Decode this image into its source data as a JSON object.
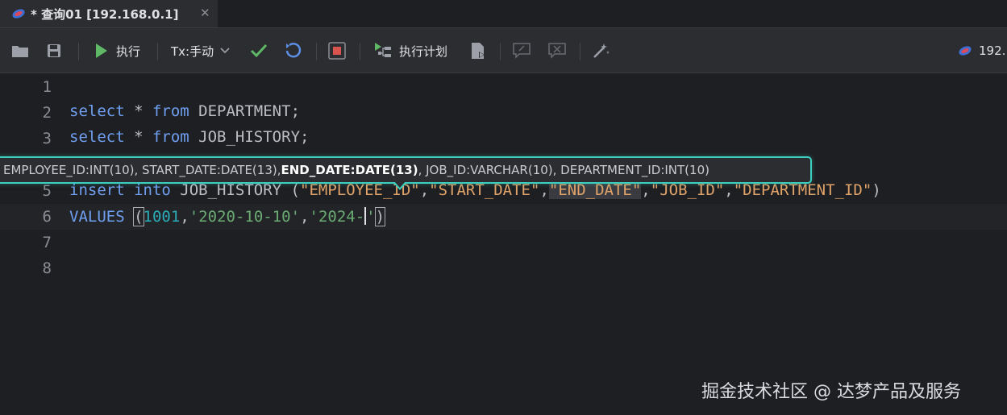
{
  "tab": {
    "title": "* 查询01 [192.168.0.1]",
    "close": "✕",
    "icon": "database-icon"
  },
  "toolbar": {
    "run_label": "执行",
    "tx_label": "Tx:手动",
    "plan_label": "执行计划",
    "conn_label": "192."
  },
  "editor": {
    "line_numbers": [
      "1",
      "2",
      "3",
      "5",
      "6",
      "7",
      "8"
    ],
    "line2": {
      "kw1": "select",
      "op": " * ",
      "kw2": "from",
      "table": " DEPARTMENT;"
    },
    "line3": {
      "kw1": "select",
      "op": " * ",
      "kw2": "from",
      "table": " JOB_HISTORY;"
    },
    "line5": {
      "kw": "insert into",
      "table": " JOB_HISTORY (",
      "c1": "\"EMPLOYEE_ID\"",
      "sep1": ",",
      "c2": "\"START_DATE\"",
      "sep2": ",",
      "c3": "\"END_DATE\"",
      "sep3": ",",
      "c4": "\"JOB_ID\"",
      "sep4": ",",
      "c5": "\"DEPARTMENT_ID\"",
      "close": ")"
    },
    "line6": {
      "kw": "VALUES",
      "sp": " ",
      "open": "(",
      "num": "1001",
      "comma1": ",",
      "s1": "'2020-10-10'",
      "comma2": ",",
      "s2": "'2024-",
      "s2end": "'",
      "close": ")"
    }
  },
  "tooltip": {
    "part1": "EMPLOYEE_ID:INT(10), START_DATE:DATE(13), ",
    "bold": "END_DATE:DATE(13)",
    "part2": ", JOB_ID:VARCHAR(10), DEPARTMENT_ID:INT(10)"
  },
  "watermark": "掘金技术社区 @ 达梦产品及服务",
  "colors": {
    "accent": "#3ccfc0",
    "keyword": "#6f9ff0",
    "string": "#6aab73",
    "number": "#2aacb8"
  }
}
